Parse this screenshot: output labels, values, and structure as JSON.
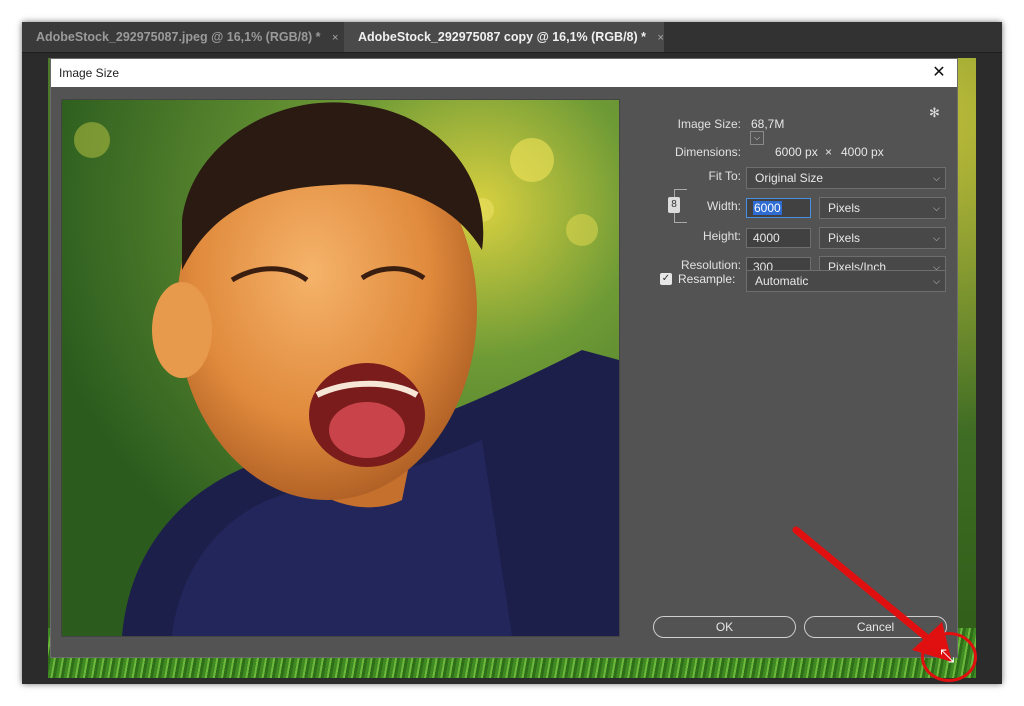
{
  "tabs": [
    {
      "label": "AdobeStock_292975087.jpeg @ 16,1% (RGB/8) *",
      "close": "×"
    },
    {
      "label": "AdobeStock_292975087 copy @ 16,1% (RGB/8) *",
      "close": "×"
    }
  ],
  "dialog": {
    "title": "Image Size",
    "close": "✕",
    "image_size_label": "Image Size:",
    "image_size_value": "68,7M",
    "dimensions_label": "Dimensions:",
    "dimensions_width": "6000 px",
    "dimensions_sep": "×",
    "dimensions_height": "4000 px",
    "fit_to_label": "Fit To:",
    "fit_to_value": "Original Size",
    "width_label": "Width:",
    "width_value": "6000",
    "width_unit": "Pixels",
    "height_label": "Height:",
    "height_value": "4000",
    "height_unit": "Pixels",
    "resolution_label": "Resolution:",
    "resolution_value": "300",
    "resolution_unit": "Pixels/Inch",
    "resample_label": "Resample:",
    "resample_value": "Automatic",
    "ok_label": "OK",
    "cancel_label": "Cancel"
  },
  "icons": {
    "chevron": "⌵",
    "gear": "✻",
    "check": "✓",
    "link": "8",
    "resize": "⤡"
  },
  "colors": {
    "annotation": "#e01010"
  }
}
